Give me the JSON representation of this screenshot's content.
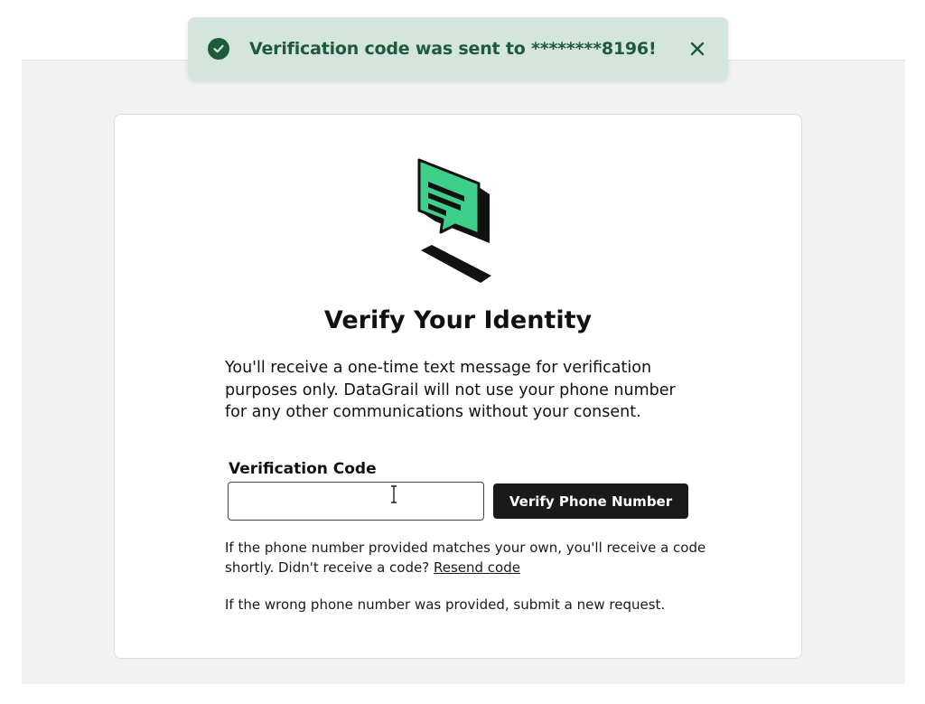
{
  "toast": {
    "message": "Verification code was sent to ********8196!",
    "icon": "check-circle-icon",
    "close_icon": "close-icon",
    "background": "#d3e5dc",
    "text_color": "#1f5a3d"
  },
  "card": {
    "illustration": "chat-bubble-icon",
    "title": "Verify Your Identity",
    "description": "You'll receive a one-time text message for verification purposes only. DataGrail will not use your phone number for any other communications without your consent.",
    "code_label": "Verification Code",
    "code_value": "",
    "code_placeholder": "",
    "verify_button": "Verify Phone Number",
    "help_text_1": "If the phone number provided matches your own, you'll receive a code shortly. Didn't receive a code?",
    "resend_link": "Resend code",
    "help_text_2": "If the wrong phone number was provided, submit a new request.",
    "accent_color": "#3ed08a",
    "button_color": "#1a1a1a"
  }
}
